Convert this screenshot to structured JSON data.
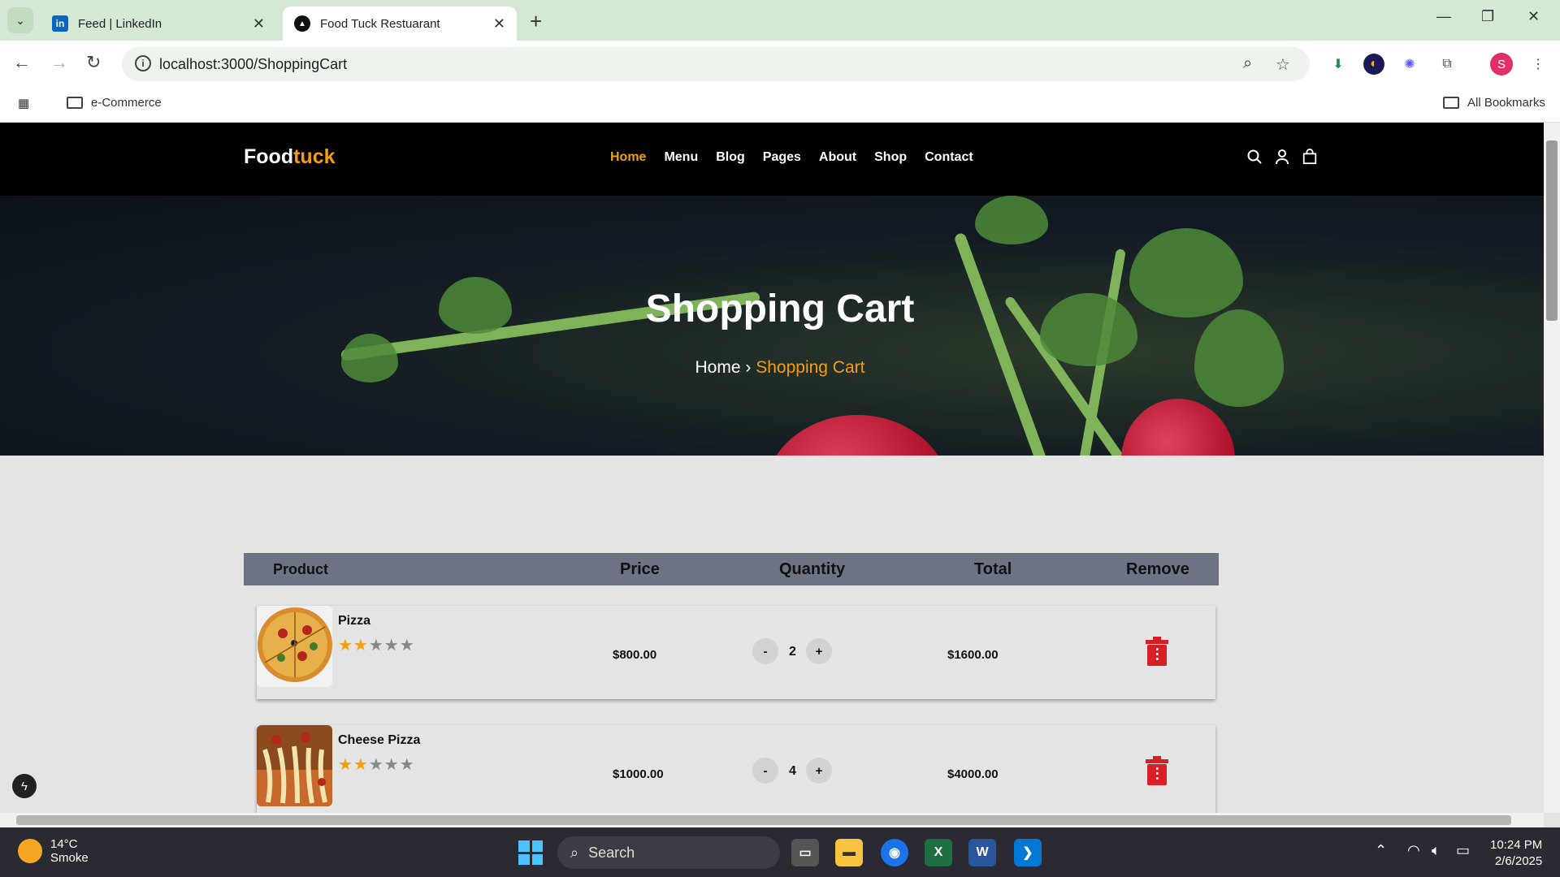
{
  "browser": {
    "tabs": [
      {
        "title": "Feed | LinkedIn",
        "active": false,
        "favicon": "linkedin-icon"
      },
      {
        "title": "Food Tuck Restuarant",
        "active": true,
        "favicon": "site-icon"
      }
    ],
    "url": "localhost:3000/ShoppingCart",
    "bookmarks": [
      {
        "label": "e-Commerce"
      }
    ],
    "all_bookmarks": "All Bookmarks",
    "profile_initial": "S"
  },
  "site": {
    "logo_main": "Food",
    "logo_accent": "tuck",
    "menu": [
      "Home",
      "Menu",
      "Blog",
      "Pages",
      "About",
      "Shop",
      "Contact"
    ],
    "active_menu": "Home",
    "accent_color": "#f59e0b"
  },
  "hero": {
    "title": "Shopping Cart",
    "breadcrumb_home": "Home",
    "breadcrumb_sep": "›",
    "breadcrumb_current": "Shopping Cart"
  },
  "cart": {
    "headers": {
      "product": "Product",
      "price": "Price",
      "quantity": "Quantity",
      "total": "Total",
      "remove": "Remove"
    },
    "items": [
      {
        "name": "Pizza",
        "rating": 2,
        "max_rating": 5,
        "price": "$800.00",
        "quantity": "2",
        "total": "$1600.00",
        "minus": "-",
        "plus": "+"
      },
      {
        "name": "Cheese Pizza",
        "rating": 2,
        "max_rating": 5,
        "price": "$1000.00",
        "quantity": "4",
        "total": "$4000.00",
        "minus": "-",
        "plus": "+"
      }
    ]
  },
  "taskbar": {
    "weather_temp": "14°C",
    "weather_desc": "Smoke",
    "search_label": "Search",
    "time": "10:24 PM",
    "date": "2/6/2025",
    "chrome_badge": "S"
  }
}
